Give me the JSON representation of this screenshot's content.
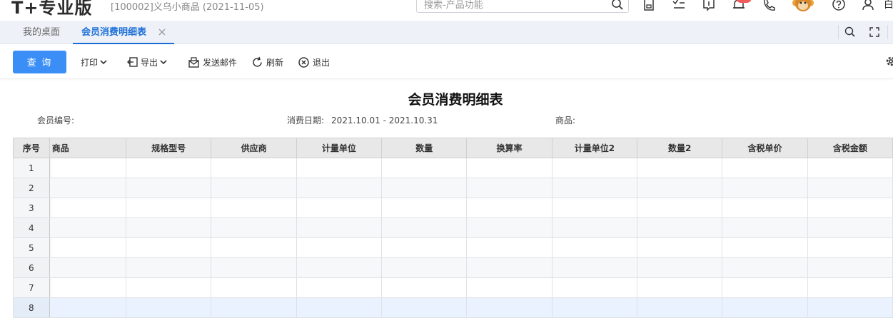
{
  "header": {
    "logo_text": "T+专业版",
    "account_info": "[100002]义乌小商品   (2021-11-05)",
    "search_placeholder": "搜索-产品功能",
    "edge_text": "白",
    "notification_badge_color": "#f25b5b"
  },
  "tabs": {
    "home_label": "我的桌面",
    "active_label": "会员消费明细表",
    "accent_color": "#1e6fd9"
  },
  "toolbar": {
    "query_label": "查 询",
    "print_label": "打印",
    "export_label": "导出",
    "email_label": "发送邮件",
    "refresh_label": "刷新",
    "exit_label": "退出",
    "primary_color": "#3a8ef6"
  },
  "report": {
    "title": "会员消费明细表",
    "filters": {
      "member_label": "会员编号:",
      "member_value": "",
      "date_label": "消费日期:",
      "date_value": "2021.10.01 - 2021.10.31",
      "goods_label": "商品:",
      "goods_value": ""
    }
  },
  "grid": {
    "columns": [
      "序号",
      "商品",
      "规格型号",
      "供应商",
      "计量单位",
      "数量",
      "换算率",
      "计量单位2",
      "数量2",
      "含税单价",
      "含税金额"
    ],
    "rows": [
      "1",
      "2",
      "3",
      "4",
      "5",
      "6",
      "7",
      "8"
    ]
  }
}
